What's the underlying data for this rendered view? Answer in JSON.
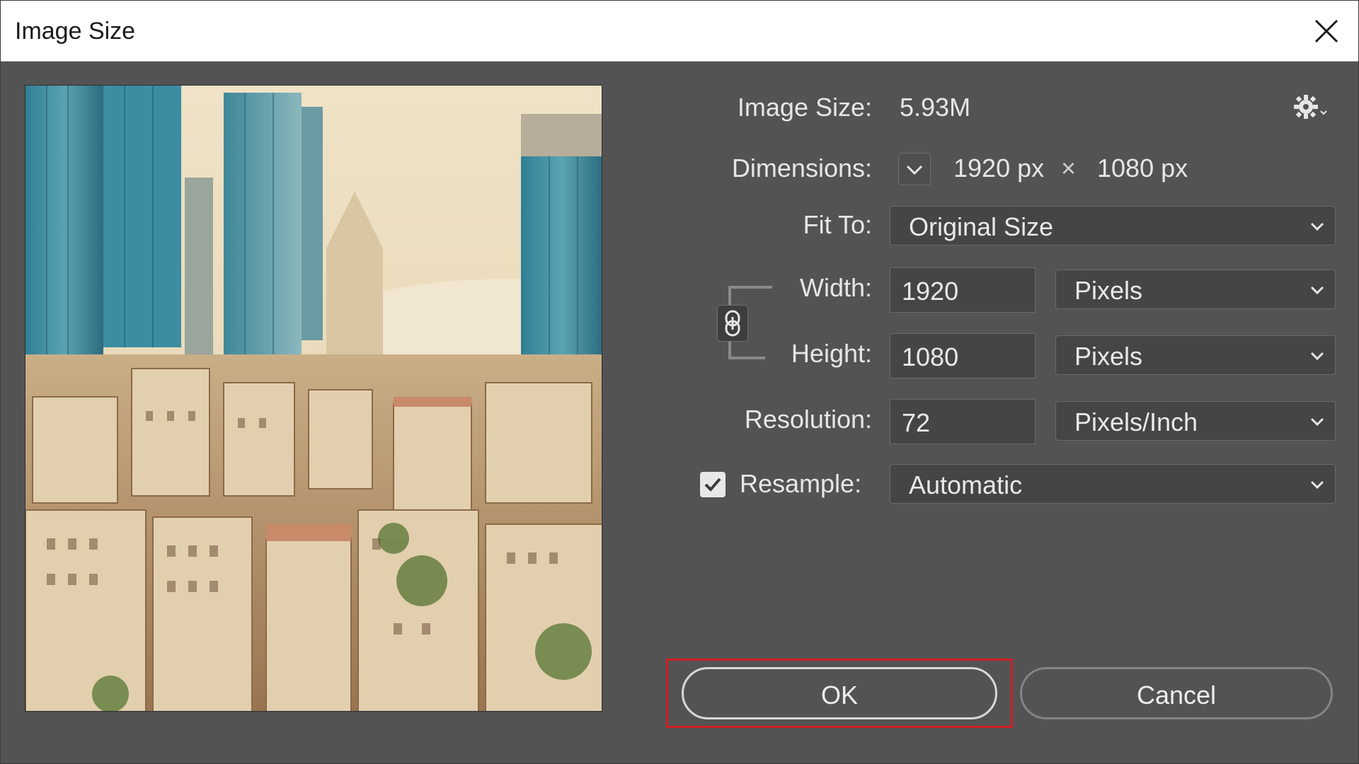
{
  "window": {
    "title": "Image Size"
  },
  "icons": {
    "close": "close-icon",
    "gear": "gear-icon",
    "chevron": "chevron-down-icon",
    "link": "link-chain-icon",
    "check": "checkmark-icon"
  },
  "info": {
    "image_size_label": "Image Size:",
    "image_size_value": "5.93M",
    "dimensions_label": "Dimensions:",
    "dim_width": "1920 px",
    "dim_times": "×",
    "dim_height": "1080 px"
  },
  "fit_to": {
    "label": "Fit To:",
    "value": "Original Size"
  },
  "width": {
    "label": "Width:",
    "value": "1920",
    "unit": "Pixels"
  },
  "height": {
    "label": "Height:",
    "value": "1080",
    "unit": "Pixels"
  },
  "resolution": {
    "label": "Resolution:",
    "value": "72",
    "unit": "Pixels/Inch"
  },
  "resample": {
    "label": "Resample:",
    "checked": true,
    "value": "Automatic"
  },
  "buttons": {
    "ok": "OK",
    "cancel": "Cancel"
  },
  "colors": {
    "dialog_bg": "#535353",
    "highlight": "#d01f24",
    "titlebar": "#ffffff"
  }
}
